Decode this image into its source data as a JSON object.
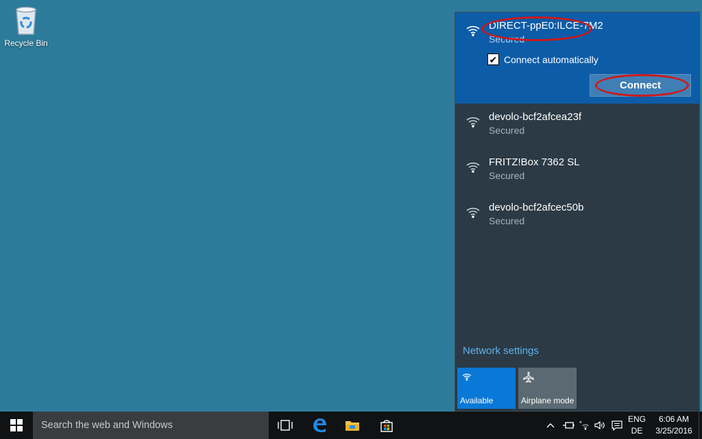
{
  "desktop": {
    "recycle_bin_label": "Recycle Bin"
  },
  "network_flyout": {
    "selected": {
      "ssid": "DIRECT-ppE0:ILCE-7M2",
      "status": "Secured",
      "auto_connect_label": "Connect automatically",
      "auto_connect_checked": true,
      "connect_label": "Connect"
    },
    "networks": [
      {
        "ssid": "devolo-bcf2afcea23f",
        "status": "Secured"
      },
      {
        "ssid": "FRITZ!Box 7362 SL",
        "status": "Secured"
      },
      {
        "ssid": "devolo-bcf2afcec50b",
        "status": "Secured"
      }
    ],
    "settings_link": "Network settings",
    "tiles": [
      {
        "label": "Available",
        "icon": "wifi-icon",
        "active": true
      },
      {
        "label": "Airplane mode",
        "icon": "airplane-icon",
        "active": false
      }
    ]
  },
  "taskbar": {
    "search_placeholder": "Search the web and Windows",
    "apps": [
      "task-view-icon",
      "edge-icon",
      "file-explorer-icon",
      "store-icon"
    ],
    "tray": {
      "language": "ENG",
      "layout": "DE",
      "time": "6:06 AM",
      "date": "3/25/2016"
    }
  },
  "colors": {
    "desktop": "#2d7b9b",
    "flyout": "#2b3a45",
    "selected_network": "#0d5ca8",
    "accent": "#0a78d7",
    "annotation": "#d01818"
  }
}
